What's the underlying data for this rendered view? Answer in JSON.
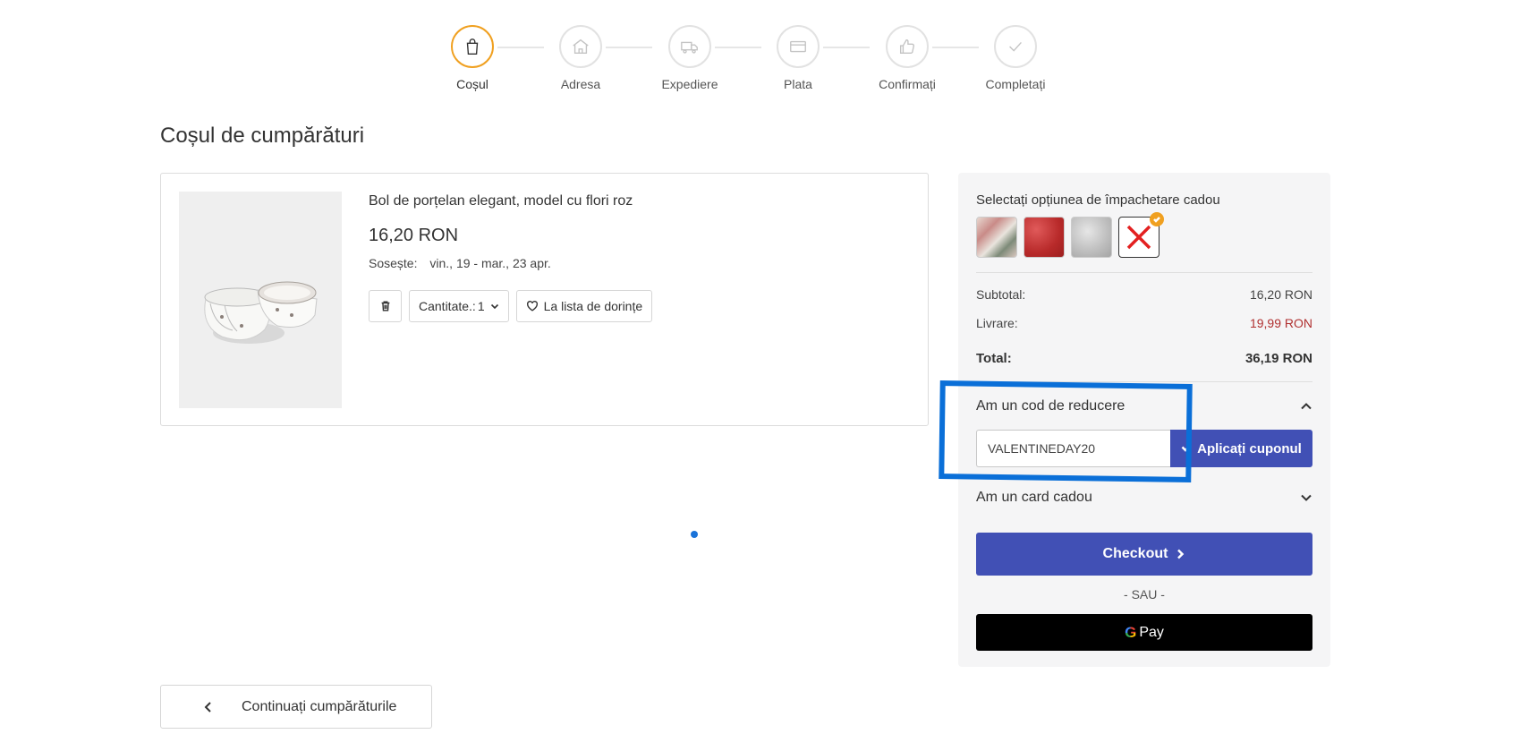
{
  "stepper": {
    "steps": [
      {
        "label": "Coșul",
        "icon": "shopping-bag-icon",
        "active": true
      },
      {
        "label": "Adresa",
        "icon": "home-icon",
        "active": false
      },
      {
        "label": "Expediere",
        "icon": "truck-icon",
        "active": false
      },
      {
        "label": "Plata",
        "icon": "credit-card-icon",
        "active": false
      },
      {
        "label": "Confirmați",
        "icon": "thumbs-up-icon",
        "active": false
      },
      {
        "label": "Completați",
        "icon": "checkmark-icon",
        "active": false
      }
    ]
  },
  "page": {
    "title": "Coșul de cumpărături"
  },
  "cart_item": {
    "name": "Bol de porțelan elegant, model cu flori roz",
    "price": "16,20 RON",
    "delivery_label": "Sosește:",
    "delivery_dates": "vin., 19 - mar., 23 apr.",
    "quantity_label": "Cantitate.:",
    "quantity_value": "1",
    "wishlist_label": "La lista de dorințe"
  },
  "summary": {
    "gift_title": "Selectați opțiunea de împachetare cadou",
    "gift_options": [
      "floral",
      "red",
      "silver",
      "none"
    ],
    "gift_selected": "none",
    "subtotal_label": "Subtotal:",
    "subtotal_value": "16,20 RON",
    "shipping_label": "Livrare:",
    "shipping_value": "19,99 RON",
    "total_label": "Total:",
    "total_value": "36,19 RON",
    "coupon_header": "Am un cod de reducere",
    "coupon_value": "VALENTINEDAY20",
    "coupon_button": "Aplicați cuponul",
    "giftcard_header": "Am un card cadou",
    "checkout_label": "Checkout",
    "or_text": "- SAU -",
    "gpay_g": "G",
    "gpay_label": "Pay"
  },
  "footer": {
    "continue_label": "Continuați cumpărăturile"
  },
  "colors": {
    "accent": "#4150b5",
    "active_step": "#f0a020",
    "shipping_text": "#b03030",
    "highlight": "#0a6fd8"
  }
}
